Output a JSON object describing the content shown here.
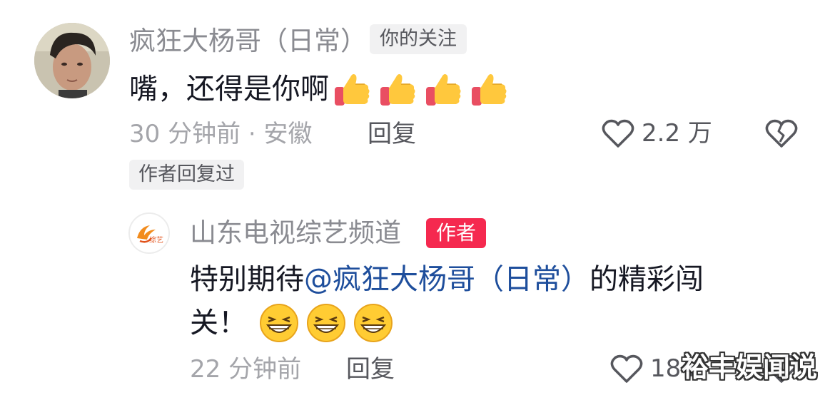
{
  "comment": {
    "username": "疯狂大杨哥（日常）",
    "follow_badge": "你的关注",
    "text": "嘴，还得是你啊",
    "emoji": "thumbs-up",
    "emoji_count": 4,
    "time_location": "30 分钟前 · 安徽",
    "reply_label": "回复",
    "like_count": "2.2 万",
    "author_replied_badge": "作者回复过"
  },
  "reply": {
    "username": "山东电视综艺频道",
    "author_badge": "作者",
    "avatar_logo_text": "综艺",
    "text_prefix": "特别期待",
    "mention": "@疯狂大杨哥（日常）",
    "text_suffix": "的精彩闯",
    "text_line2": "关！",
    "emoji": "grin-squint",
    "emoji_count": 3,
    "time": "22 分钟前",
    "reply_label": "回复",
    "like_count": "184"
  },
  "watermark": "裕丰娱闻说",
  "colors": {
    "secondary_text": "#8a8b91",
    "primary_text": "#161823",
    "mention": "#1e4e9c",
    "author_badge_bg": "#f5294f",
    "badge_bg": "#f1f1f2"
  }
}
